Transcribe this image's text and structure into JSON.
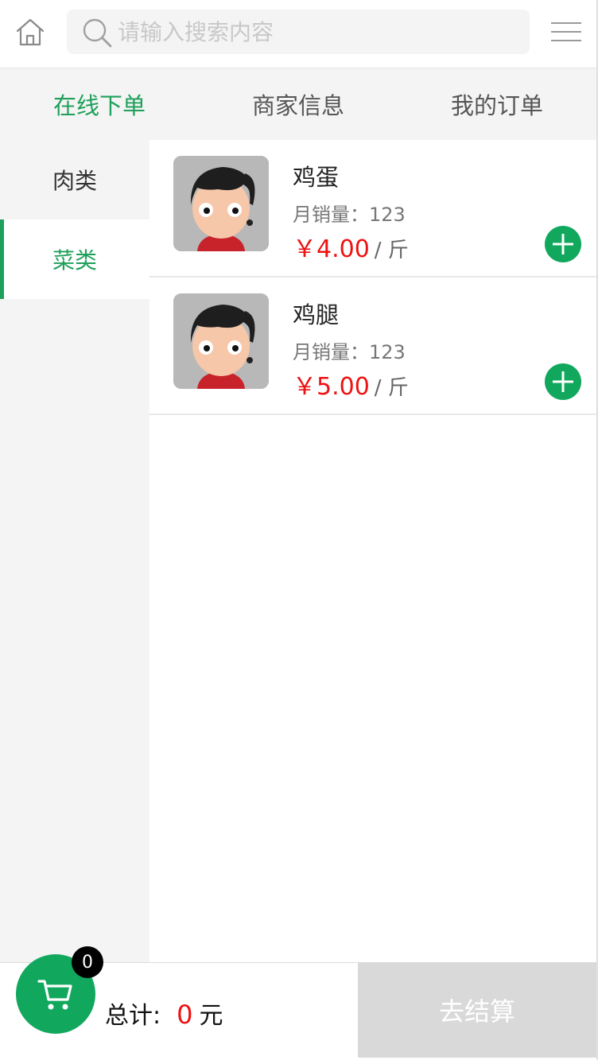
{
  "header": {
    "search_placeholder": "请输入搜索内容",
    "icons": {
      "home": "home-icon",
      "search": "search-icon",
      "menu": "menu-icon"
    }
  },
  "tabs": [
    {
      "label": "在线下单",
      "active": true
    },
    {
      "label": "商家信息",
      "active": false
    },
    {
      "label": "我的订单",
      "active": false
    }
  ],
  "categories": [
    {
      "label": "肉类",
      "active": false
    },
    {
      "label": "菜类",
      "active": true
    }
  ],
  "products": [
    {
      "name": "鸡蛋",
      "sales": "月销量：123",
      "price": "￥4.00",
      "unit": "/ 斤"
    },
    {
      "name": "鸡腿",
      "sales": "月销量：123",
      "price": "￥5.00",
      "unit": "/ 斤"
    }
  ],
  "cart": {
    "count": "0",
    "total_label": "总计:",
    "total_amount": "0",
    "currency": "元",
    "checkout_label": "去结算"
  },
  "colors": {
    "accent": "#1fa05a",
    "button_green": "#11a85e",
    "price_red": "#ee1111",
    "checkout_disabled": "#d9d9d9"
  }
}
